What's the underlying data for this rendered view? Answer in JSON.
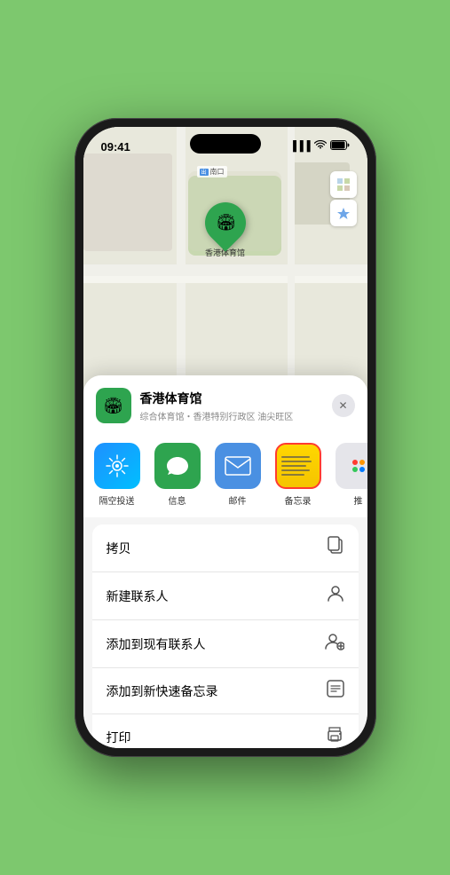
{
  "status_bar": {
    "time": "09:41",
    "signal": "●●●",
    "wifi": "WiFi",
    "battery": "Battery"
  },
  "map": {
    "label_text": "南口",
    "controls": {
      "map_icon": "🗺",
      "location_icon": "➤"
    },
    "pin": {
      "label": "香港体育馆"
    }
  },
  "venue": {
    "name": "香港体育馆",
    "subtitle": "综合体育馆・香港特别行政区 油尖旺区",
    "close_label": "×"
  },
  "apps": [
    {
      "id": "airdrop",
      "label": "隔空投送",
      "type": "airdrop"
    },
    {
      "id": "message",
      "label": "信息",
      "type": "message"
    },
    {
      "id": "mail",
      "label": "邮件",
      "type": "mail"
    },
    {
      "id": "notes",
      "label": "备忘录",
      "type": "notes"
    },
    {
      "id": "more",
      "label": "推",
      "type": "more"
    }
  ],
  "actions": [
    {
      "id": "copy",
      "label": "拷贝",
      "icon": "copy"
    },
    {
      "id": "new-contact",
      "label": "新建联系人",
      "icon": "person"
    },
    {
      "id": "add-existing",
      "label": "添加到现有联系人",
      "icon": "person-add"
    },
    {
      "id": "add-note",
      "label": "添加到新快速备忘录",
      "icon": "note"
    },
    {
      "id": "print",
      "label": "打印",
      "icon": "print"
    }
  ]
}
